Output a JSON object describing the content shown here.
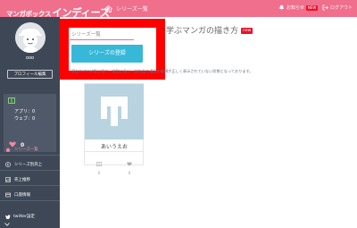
{
  "header": {
    "logo_small": "マンガボックス",
    "logo_big": "インディーズ",
    "home_label": "シリーズ一覧",
    "notice_label": "お知らせ",
    "notice_badge": "NEW",
    "logout_label": "ログアウト"
  },
  "sidebar": {
    "username": "ooo",
    "profile_button": "プロフィール編集",
    "stats": {
      "app_label": "アプリ：",
      "app_value": "0",
      "web_label": "ウェブ：",
      "web_value": "0",
      "likes": "0"
    },
    "nav": [
      {
        "label": "シリーズ一覧",
        "icon": "home-icon"
      },
      {
        "label": "シリーズ別売上",
        "icon": "chart-icon"
      },
      {
        "label": "売上推移",
        "icon": "trend-icon"
      },
      {
        "label": "口座情報",
        "icon": "bank-icon"
      }
    ],
    "twitter_label": "twitter設定"
  },
  "main": {
    "tab_label": "シリーズ一覧",
    "heading": "学ぶマンガの描き方",
    "heading_badge": "new",
    "series_button": "シリーズの登録",
    "notice": "現在Android版に限り、縦型に長い一部作品の漫画の縦横が正しく表示されていない状態となっております。",
    "card": {
      "title": "あいうえお",
      "views": "0",
      "likes": "0"
    }
  },
  "colors": {
    "header_pink": "#ef6f8c",
    "sidebar": "#3d4756",
    "button_blue": "#38b8d8",
    "highlight_red": "#ff0000"
  }
}
